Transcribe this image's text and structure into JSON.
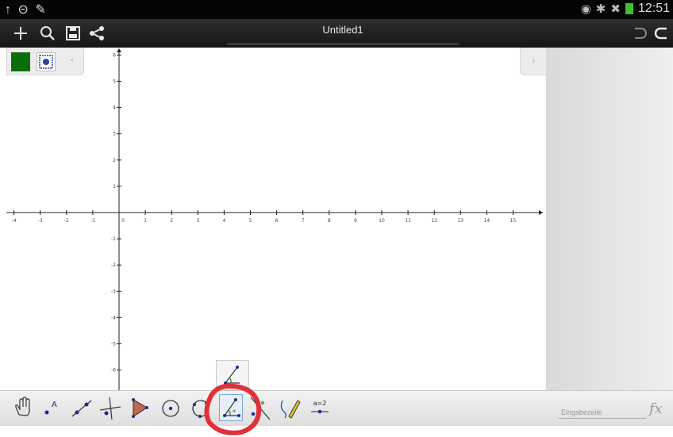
{
  "status_bar": {
    "left_icons": [
      "upload-icon",
      "minus-circle-icon",
      "pencil-icon"
    ],
    "right_icons": [
      "eye-icon",
      "bluetooth-icon",
      "no-signal-icon",
      "battery-icon"
    ],
    "time": "12:51",
    "battery_color": "#3fbf2f"
  },
  "toolbar": {
    "title": "Untitled1",
    "left_icons": [
      "plus-icon",
      "search-icon",
      "save-icon",
      "share-icon"
    ],
    "right_icons": [
      "undo-icon",
      "redo-icon"
    ]
  },
  "style_bar": {
    "color_swatch": "#0a6e0a"
  },
  "graphics": {
    "x_axis_labels": [
      "-4",
      "-3",
      "-2",
      "-1",
      "0",
      "1",
      "2",
      "3",
      "4",
      "5",
      "6",
      "7",
      "8",
      "9",
      "10",
      "11",
      "12",
      "13",
      "14",
      "15"
    ],
    "y_axis_labels": [
      "6",
      "5",
      "4",
      "3",
      "2",
      "1",
      "-1",
      "-2",
      "-3",
      "-4",
      "-5",
      "-6"
    ]
  },
  "tools": [
    {
      "name": "move-tool",
      "icon": "hand-icon"
    },
    {
      "name": "point-tool",
      "icon": "point-a-icon"
    },
    {
      "name": "line-tool",
      "icon": "line-icon"
    },
    {
      "name": "perpendicular-tool",
      "icon": "perpendicular-icon"
    },
    {
      "name": "polygon-tool",
      "icon": "polygon-icon"
    },
    {
      "name": "circle-tool",
      "icon": "circle-icon"
    },
    {
      "name": "circle-three-points-tool",
      "icon": "circle-three-points-icon"
    },
    {
      "name": "angle-tool",
      "icon": "angle-icon",
      "active": true
    },
    {
      "name": "reflect-tool",
      "icon": "reflect-icon"
    },
    {
      "name": "freehand-tool",
      "icon": "pen-icon"
    },
    {
      "name": "slider-tool",
      "icon": "slider-icon",
      "label": "a=2"
    }
  ],
  "input_bar": {
    "placeholder": "Eingabezeile",
    "fx_label": "fx"
  },
  "accent_colors": {
    "annotation_ring": "#e0303a",
    "active_tool_border": "#7aa6d6"
  }
}
